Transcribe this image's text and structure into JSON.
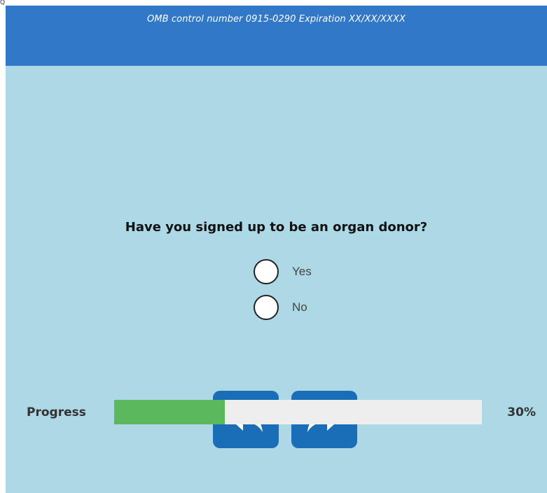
{
  "header": {
    "omb_text": "OMB control number 0915-0290 Expiration XX/XX/XXXX",
    "background_color": "#3278c8"
  },
  "question": {
    "text": "Have you signed up to be an organ donor?"
  },
  "options": [
    {
      "label": "Yes",
      "selected": false
    },
    {
      "label": "No",
      "selected": false
    }
  ],
  "navigation": {
    "back_icon": "back-arrow-icon",
    "next_icon": "forward-arrow-icon",
    "button_color": "#1a6eb8"
  },
  "progress": {
    "label": "Progress",
    "percent_text": "30%",
    "value": 0.3,
    "fill_color": "#5cb85c"
  },
  "colors": {
    "content_background": "#add8e6"
  }
}
